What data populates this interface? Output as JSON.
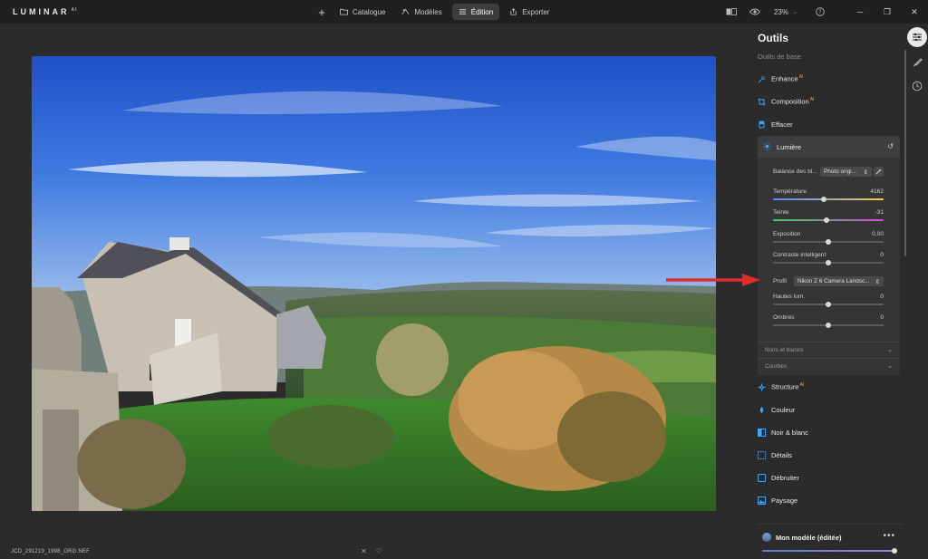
{
  "app": {
    "logo": "LUMINAR",
    "logo_suffix": "AI"
  },
  "topnav": {
    "add_icon": "plus-icon",
    "items": [
      {
        "label": "Catalogue",
        "icon": "folder-icon",
        "active": false
      },
      {
        "label": "Modèles",
        "icon": "templates-icon",
        "active": false
      },
      {
        "label": "Édition",
        "icon": "sliders-icon",
        "active": true
      },
      {
        "label": "Exporter",
        "icon": "export-icon",
        "active": false
      }
    ]
  },
  "topright": {
    "zoom": "23%"
  },
  "photo": {
    "alt": ""
  },
  "status": {
    "filename": "JCD_291219_1998_ORG.NEF"
  },
  "panel": {
    "title": "Outils",
    "subtitle": "Outils de base",
    "tools_top": [
      {
        "label": "Enhance",
        "ai": "AI",
        "icon": "enhance-icon"
      },
      {
        "label": "Composition",
        "ai": "AI",
        "icon": "crop-icon"
      },
      {
        "label": "Effacer",
        "ai": "",
        "icon": "eraser-icon"
      }
    ],
    "lumiere": {
      "title": "Lumière",
      "wb_label": "Balance des bl...",
      "wb_value": "Photo origi...",
      "sliders": [
        {
          "label": "Température",
          "value": "4162",
          "pos": 0.46
        },
        {
          "label": "Teinte",
          "value": "-31",
          "pos": 0.48
        },
        {
          "label": "Exposition",
          "value": "0,00",
          "pos": 0.5
        },
        {
          "label": "Contraste intelligent",
          "value": "0",
          "pos": 0.5
        }
      ],
      "profile_label": "Profil",
      "profile_value": "Nikon Z 6 Camera Landsc...",
      "sliders2": [
        {
          "label": "Hautes lum.",
          "value": "0",
          "pos": 0.5
        },
        {
          "label": "Ombres",
          "value": "0",
          "pos": 0.5
        }
      ],
      "sections": [
        "Noirs et blancs",
        "Courbes"
      ]
    },
    "tools_bottom": [
      {
        "label": "Structure",
        "ai": "AI",
        "icon": "structure-icon"
      },
      {
        "label": "Couleur",
        "ai": "",
        "icon": "color-icon"
      },
      {
        "label": "Noir & blanc",
        "ai": "",
        "icon": "bw-icon"
      },
      {
        "label": "Détails",
        "ai": "",
        "icon": "details-icon"
      },
      {
        "label": "Débruiter",
        "ai": "",
        "icon": "denoise-icon"
      },
      {
        "label": "Paysage",
        "ai": "",
        "icon": "landscape-icon"
      }
    ],
    "preset": {
      "name": "Mon modèle (éditée)",
      "amount": 1.0
    }
  },
  "colors": {
    "accent_blue": "#3aa7ff",
    "arrow_red": "#e32b2b",
    "temp_gradient": [
      "#4a8bff",
      "#ffc94a"
    ],
    "tint_gradient": [
      "#3ecf5a",
      "#d84ad8"
    ]
  }
}
